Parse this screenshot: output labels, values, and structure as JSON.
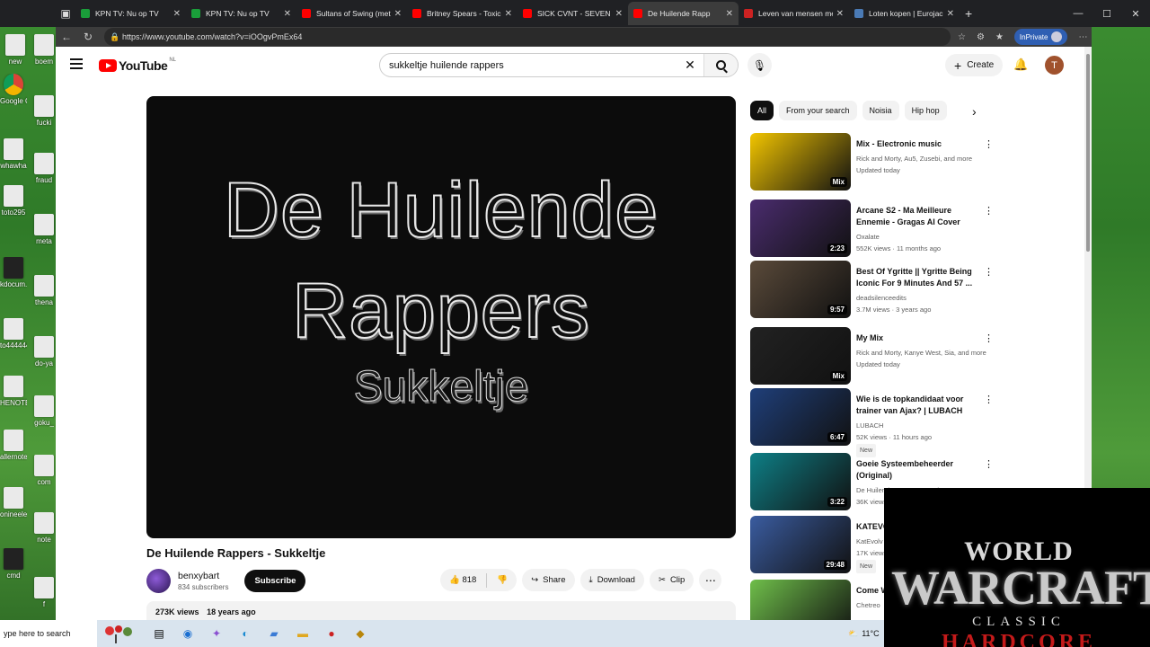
{
  "desktop": {
    "icons": [
      {
        "label": "new",
        "style": "plain"
      },
      {
        "label": "boem",
        "style": "plain"
      },
      {
        "label": "Google Chrome",
        "style": "chrome"
      },
      {
        "label": "fucki",
        "style": "plain"
      },
      {
        "label": "whawha",
        "style": "plain"
      },
      {
        "label": "fraud",
        "style": "plain"
      },
      {
        "label": "toto295",
        "style": "plain"
      },
      {
        "label": "meta",
        "style": "plain"
      },
      {
        "label": "kdocum...",
        "style": "dark"
      },
      {
        "label": "thena",
        "style": "plain"
      },
      {
        "label": "to444444",
        "style": "plain"
      },
      {
        "label": "do-ya",
        "style": "plain"
      },
      {
        "label": "HENOTE",
        "style": "plain"
      },
      {
        "label": "goku_",
        "style": "plain"
      },
      {
        "label": "allernote",
        "style": "plain"
      },
      {
        "label": "com",
        "style": "plain"
      },
      {
        "label": "onineele...",
        "style": "plain"
      },
      {
        "label": "note",
        "style": "plain"
      },
      {
        "label": "cmd",
        "style": "dark"
      },
      {
        "label": "f",
        "style": "plain"
      }
    ]
  },
  "browser": {
    "tabs": [
      {
        "title": "KPN TV: Nu op TV",
        "fav_color": "#1a9e3a",
        "active": false
      },
      {
        "title": "KPN TV: Nu op TV",
        "fav_color": "#1a9e3a",
        "active": false
      },
      {
        "title": "Sultans of Swing (metal",
        "fav_color": "#ff0000",
        "active": false
      },
      {
        "title": "Britney Spears - Toxic (",
        "fav_color": "#ff0000",
        "active": false
      },
      {
        "title": "SICK CVNT - SEVEN NA",
        "fav_color": "#ff0000",
        "active": false
      },
      {
        "title": "De Huilende Rapp",
        "fav_color": "#ff0000",
        "active": true
      },
      {
        "title": "Leven van mensen met",
        "fav_color": "#cc2222",
        "active": false
      },
      {
        "title": "Loten kopen | Eurojack",
        "fav_color": "#4a7ab5",
        "active": false
      }
    ],
    "url": "https://www.youtube.com/watch?v=iOOgvPmEx64",
    "inprivate_label": "InPrivate"
  },
  "youtube": {
    "logo_text": "YouTube",
    "country_code": "NL",
    "search_value": "sukkeltje huilende rappers",
    "create_label": "Create",
    "avatar_letter": "T",
    "player": {
      "line1": "De Huilende",
      "line2": "Rappers",
      "line3": "Sukkeltje"
    },
    "video": {
      "title": "De Huilende Rappers - Sukkeltje",
      "channel": "benxybart",
      "subscribers": "834 subscribers",
      "subscribe_label": "Subscribe",
      "likes": "818",
      "share_label": "Share",
      "download_label": "Download",
      "clip_label": "Clip",
      "views": "273K views",
      "age": "18 years ago"
    },
    "chips": [
      "All",
      "From your search",
      "Noisia",
      "Hip hop"
    ],
    "recommendations": [
      {
        "title": "Mix - Electronic music",
        "meta1": "Rick and Morty, Au5, Zusebi, and more",
        "meta2": "Updated today",
        "badge": "Mix",
        "new": false,
        "thumb": "#f2c500"
      },
      {
        "title": "Arcane S2 - Ma Meilleure Ennemie - Gragas AI Cover",
        "meta1": "Oxalate",
        "meta2": "552K views · 11 months ago",
        "badge": "2:23",
        "new": false,
        "thumb": "#4a2c6e"
      },
      {
        "title": "Best Of Ygritte || Ygritte Being Iconic For 9 Minutes And 57 ...",
        "meta1": "deadsilenceedits",
        "meta2": "3.7M views · 3 years ago",
        "badge": "9:57",
        "new": false,
        "thumb": "#5a4a3a"
      },
      {
        "title": "My Mix",
        "meta1": "Rick and Morty, Kanye West, Sia, and more",
        "meta2": "Updated today",
        "badge": "Mix",
        "new": false,
        "thumb": "#222222"
      },
      {
        "title": "Wie is de topkandidaat voor trainer van Ajax? | LUBACH",
        "meta1": "LUBACH",
        "meta2": "52K views · 11 hours ago",
        "badge": "6:47",
        "new": true,
        "thumb": "#1f3f7a"
      },
      {
        "title": "Goeie Systeembeheerder (Original)",
        "meta1": "De Huilende Rappers - Topic",
        "meta2": "36K views",
        "badge": "3:22",
        "new": false,
        "thumb": "#0e7f86"
      },
      {
        "title": "KATEVO PLAYBO",
        "meta1": "KatEvolv",
        "meta2": "17K views",
        "badge": "29:48",
        "new": true,
        "thumb": "#3a5ca0"
      },
      {
        "title": "Come W Morty R",
        "meta1": "Chetreo",
        "meta2": "",
        "badge": "",
        "new": false,
        "thumb": "#6fbf4a"
      }
    ],
    "new_label": "New"
  },
  "overlay": {
    "line1": "WORLD",
    "line2": "WARCRAFT",
    "line3": "CLASSIC",
    "line4": "HARDCORE"
  },
  "taskbar": {
    "search_placeholder": "ype here to search",
    "weather": "11°C"
  }
}
